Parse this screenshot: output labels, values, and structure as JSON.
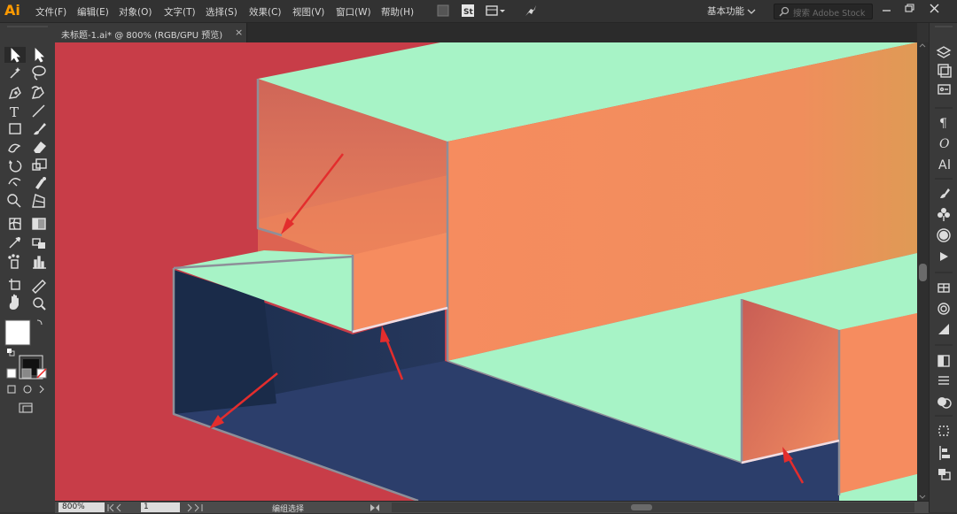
{
  "app": {
    "logo": "Ai"
  },
  "menu": [
    "文件(F)",
    "编辑(E)",
    "对象(O)",
    "文字(T)",
    "选择(S)",
    "效果(C)",
    "视图(V)",
    "窗口(W)",
    "帮助(H)"
  ],
  "workspace": {
    "label": "基本功能"
  },
  "search": {
    "placeholder": "搜索 Adobe Stock"
  },
  "document_tab": {
    "title": "未标题-1.ai* @ 800% (RGB/GPU 预览)",
    "close": "×"
  },
  "statusbar": {
    "zoom": "800%",
    "page": "1",
    "status": "编组选择"
  },
  "icons": {
    "toolbar": [
      "selection-icon",
      "direct-selection-icon",
      "magic-wand-icon",
      "lasso-icon",
      "pen-icon",
      "curvature-icon",
      "type-icon",
      "line-icon",
      "rectangle-icon",
      "paintbrush-icon",
      "shaper-icon",
      "eraser-icon",
      "rotate-icon",
      "scale-icon",
      "width-icon",
      "puppet-warp-icon",
      "shape-builder-icon",
      "perspective-grid-icon",
      "mesh-icon",
      "gradient-icon",
      "eyedropper-icon",
      "blend-icon",
      "symbol-sprayer-icon",
      "column-graph-icon",
      "artboard-icon",
      "slice-icon",
      "hand-icon",
      "zoom-icon"
    ],
    "panel": [
      "layers-icon",
      "libraries-icon",
      "properties-icon",
      "paragraph-icon",
      "opentype-icon",
      "character-icon",
      "brushes-icon",
      "symbols-icon",
      "graphic-styles-icon",
      "actions-icon",
      "swatches-icon",
      "stroke-icon",
      "gradient-panel-icon",
      "transparency-icon",
      "appearance-icon",
      "align-icon",
      "transform-icon",
      "pathfinder-icon"
    ]
  },
  "colors": {
    "canvas_red": "#C83D48",
    "mint": "#A7F3C6",
    "orange": "#F68C5F",
    "navy": "#2C3E6B",
    "arrow": "#E32D2D"
  }
}
